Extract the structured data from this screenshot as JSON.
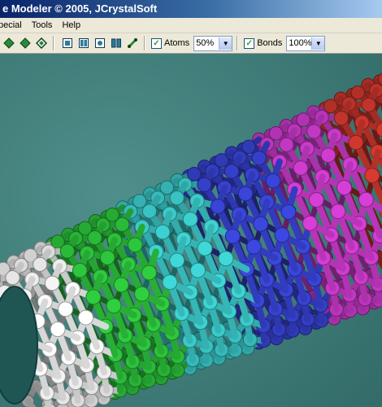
{
  "window": {
    "title": "e Modeler © 2005, JCrystalSoft"
  },
  "menubar": {
    "items": [
      "pecial",
      "Tools",
      "Help"
    ]
  },
  "toolbar": {
    "atoms_label": "Atoms",
    "atoms_checked": true,
    "atoms_value": "50%",
    "bonds_label": "Bonds",
    "bonds_checked": true,
    "bonds_value": "100%"
  },
  "viewport": {
    "background": "#3f7f7c",
    "tube_colors": [
      "#ffffff",
      "#2fcf3f",
      "#3fd8d8",
      "#3b47e0",
      "#d83ed8",
      "#d83a30"
    ]
  }
}
